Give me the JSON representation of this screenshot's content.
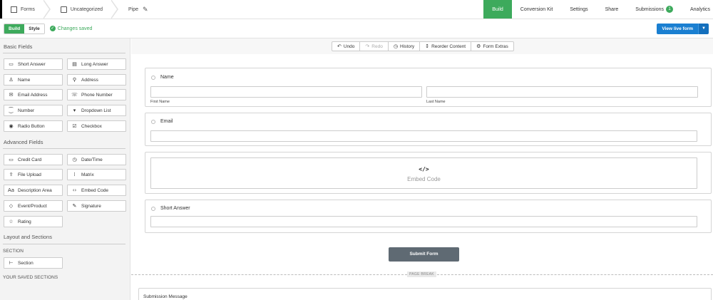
{
  "breadcrumbs": [
    {
      "label": "Forms",
      "icon": "forms-icon"
    },
    {
      "label": "Uncategorized",
      "icon": "folder-icon"
    },
    {
      "label": "Pipe",
      "icon": "pencil-icon"
    }
  ],
  "nav": {
    "build": "Build",
    "conversion_kit": "Conversion Kit",
    "settings": "Settings",
    "share": "Share",
    "submissions": "Submissions",
    "submissions_count": "1",
    "analytics": "Analytics",
    "accent_color": "#3daa5c"
  },
  "subbar": {
    "build_label": "Build",
    "style_label": "Style",
    "saved_label": "Changes saved",
    "view_live": "View live form"
  },
  "sidebar": {
    "basic_title": "Basic Fields",
    "basic": [
      "Short Answer",
      "Long Answer",
      "Name",
      "Address",
      "Email Address",
      "Phone Number",
      "Number",
      "Dropdown List",
      "Radio Button",
      "Checkbox"
    ],
    "advanced_title": "Advanced Fields",
    "advanced": [
      "Credit Card",
      "Date/Time",
      "File Upload",
      "Matrix",
      "Description Area",
      "Embed Code",
      "Event/Product",
      "Signature",
      "Rating"
    ],
    "layout_title": "Layout and Sections",
    "section_caption": "SECTION",
    "section_item": "Section",
    "saved_caption": "YOUR SAVED SECTIONS"
  },
  "toolbar": {
    "undo": "Undo",
    "redo": "Redo",
    "history": "History",
    "reorder": "Reorder Content",
    "extras": "Form Extras"
  },
  "form": {
    "name_label": "Name",
    "first_name": "First Name",
    "last_name": "Last Name",
    "email_label": "Email",
    "embed_symbol": "</>",
    "embed_caption": "Embed Code",
    "short_label": "Short Answer",
    "submit": "Submit Form",
    "page_break": "PAGE BREAK",
    "submission_message": "Submission Message"
  }
}
